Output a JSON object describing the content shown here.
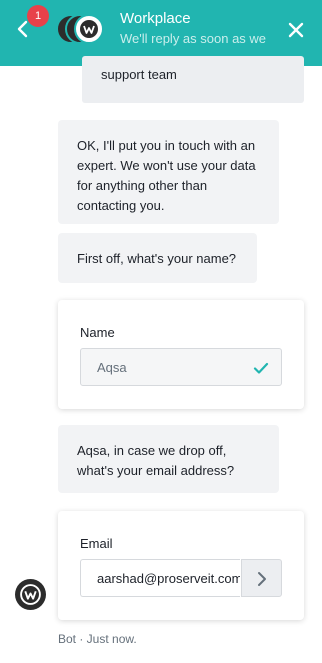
{
  "header": {
    "badge_count": "1",
    "title": "Workplace",
    "subtitle": "We'll reply as soon as we",
    "bg_color": "#21b5b0",
    "back_icon": "chevron-left-icon",
    "close_icon": "close-icon"
  },
  "messages": {
    "user_partial": "support team",
    "bot1": "OK, I'll put you in touch with an expert. We won't use your data for anything other than contacting you.",
    "bot2": "First off, what's your name?",
    "bot3": "Aqsa, in case we drop off, what's your email address?"
  },
  "name_form": {
    "label": "Name",
    "value": "Aqsa",
    "status_icon": "check-icon"
  },
  "email_form": {
    "label": "Email",
    "value": "aarshad@proserveit.com",
    "submit_icon": "chevron-right-icon"
  },
  "footer": {
    "meta": "Bot · Just now."
  }
}
